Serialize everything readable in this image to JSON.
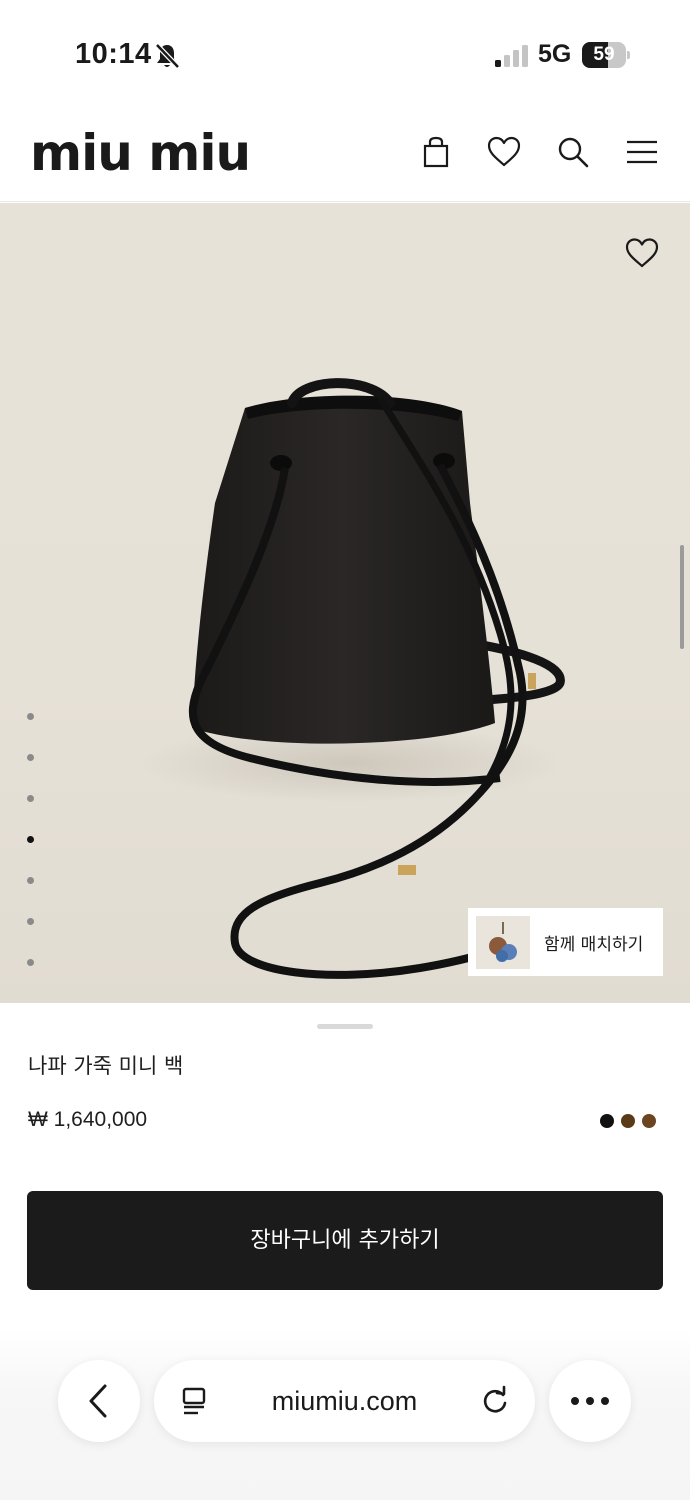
{
  "status_bar": {
    "time": "10:14",
    "network": "5G",
    "battery_level": "59",
    "battery_fraction": 0.59
  },
  "header": {
    "logo": "miu miu",
    "icons": [
      "shopping-bag-icon",
      "heart-icon",
      "search-icon",
      "menu-icon"
    ]
  },
  "gallery": {
    "image_count": 7,
    "active_index": 3,
    "match_label": "함께 매치하기"
  },
  "product": {
    "name": "나파 가죽 미니 백",
    "price": "₩ 1,640,000",
    "colors": [
      "#111111",
      "#5b3a17",
      "#6a4520"
    ]
  },
  "cart": {
    "button_label": "장바구니에 추가하기"
  },
  "browser": {
    "url": "miumiu.com",
    "icons": [
      "back-icon",
      "reader-icon",
      "reload-icon",
      "more-icon"
    ]
  }
}
